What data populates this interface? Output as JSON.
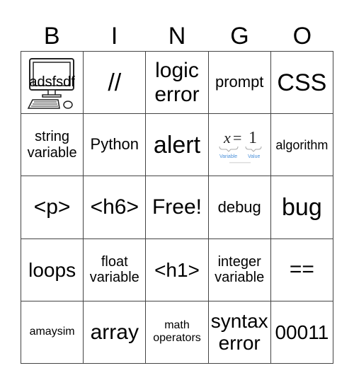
{
  "header": [
    "B",
    "I",
    "N",
    "G",
    "O"
  ],
  "cells": [
    {
      "text": "adsfsdf",
      "image": "computer-icon"
    },
    {
      "text": "//"
    },
    {
      "text": "logic error"
    },
    {
      "text": "prompt"
    },
    {
      "text": "CSS"
    },
    {
      "text": "string variable"
    },
    {
      "text": "Python"
    },
    {
      "text": "alert"
    },
    {
      "text": "",
      "image": "variable-equation",
      "equation": {
        "lhs": "x",
        "op": "=",
        "rhs": "1",
        "lhs_label": "Variable",
        "rhs_label": "Value"
      }
    },
    {
      "text": "algorithm"
    },
    {
      "text": "<p>"
    },
    {
      "text": "<h6>"
    },
    {
      "text": "Free!"
    },
    {
      "text": "debug"
    },
    {
      "text": "bug"
    },
    {
      "text": "loops"
    },
    {
      "text": "float variable"
    },
    {
      "text": "<h1>"
    },
    {
      "text": "integer variable"
    },
    {
      "text": "=="
    },
    {
      "text": "amaysim"
    },
    {
      "text": "array"
    },
    {
      "text": "math operators"
    },
    {
      "text": "syntax error"
    },
    {
      "text": "00011"
    }
  ],
  "colors": {
    "equation_label": "#4a90d9",
    "grid_line": "#444444"
  }
}
